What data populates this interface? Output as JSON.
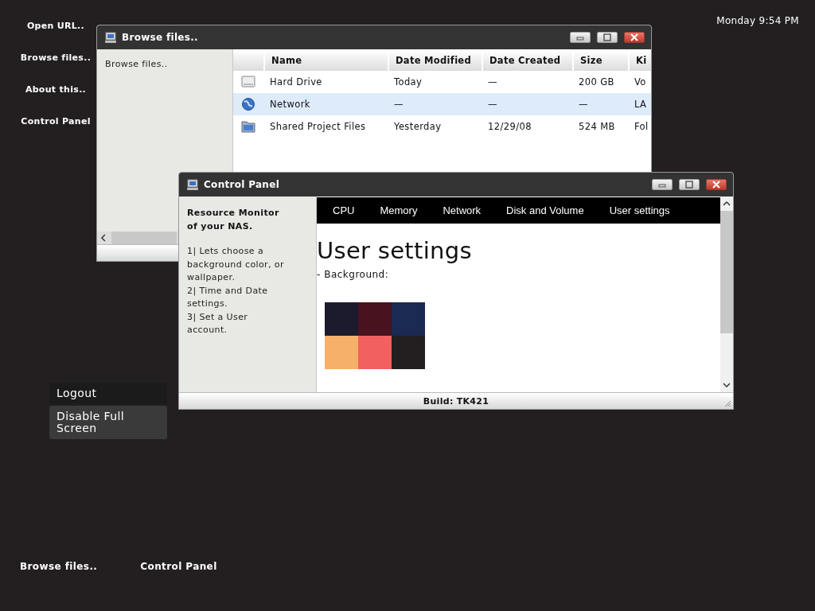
{
  "desktop_icons": [
    {
      "label": "Open URL.."
    },
    {
      "label": "Browse files.."
    },
    {
      "label": "About this.."
    },
    {
      "label": "Control Panel"
    }
  ],
  "clock": "Monday 9:54 PM",
  "browse_window": {
    "title": "Browse files..",
    "sidebar_text": "Browse files..",
    "columns": [
      "Name",
      "Date Modified",
      "Date Created",
      "Size",
      "Ki"
    ],
    "rows": [
      {
        "kind": "drive",
        "selected": false,
        "cells": [
          "Hard Drive",
          "Today",
          "—",
          "200 GB",
          "Vo"
        ]
      },
      {
        "kind": "network",
        "selected": true,
        "cells": [
          "Network",
          "—",
          "—",
          "—",
          "LA"
        ]
      },
      {
        "kind": "folder",
        "selected": false,
        "cells": [
          "Shared Project Files",
          "Yesterday",
          "12/29/08",
          "524 MB",
          "Fol"
        ]
      }
    ]
  },
  "control_panel": {
    "title": "Control Panel",
    "sidebar_heading": "Resource Monitor of your NAS.",
    "sidebar_items": [
      "1| Lets choose a background color, or wallpaper.",
      "2| Time and Date settings.",
      "3| Set a User account."
    ],
    "tabs": [
      {
        "label": "CPU"
      },
      {
        "label": "Memory"
      },
      {
        "label": "Network"
      },
      {
        "label": "Disk and Volume"
      },
      {
        "label": "User settings"
      }
    ],
    "heading": "User settings",
    "background_label": "- Background:",
    "swatches": [
      {
        "color": "#1c1b2e"
      },
      {
        "color": "#48121e"
      },
      {
        "color": "#1a2a52"
      },
      {
        "color": "#f5b06a"
      },
      {
        "color": "#f26060"
      },
      {
        "color": "#231f20"
      }
    ],
    "status": "Build: TK421"
  },
  "menu": [
    {
      "label": "Logout",
      "selected": false
    },
    {
      "label": "Disable Full Screen",
      "selected": true
    }
  ],
  "taskbar": [
    {
      "label": "Browse files.."
    },
    {
      "label": "Control Panel"
    }
  ]
}
